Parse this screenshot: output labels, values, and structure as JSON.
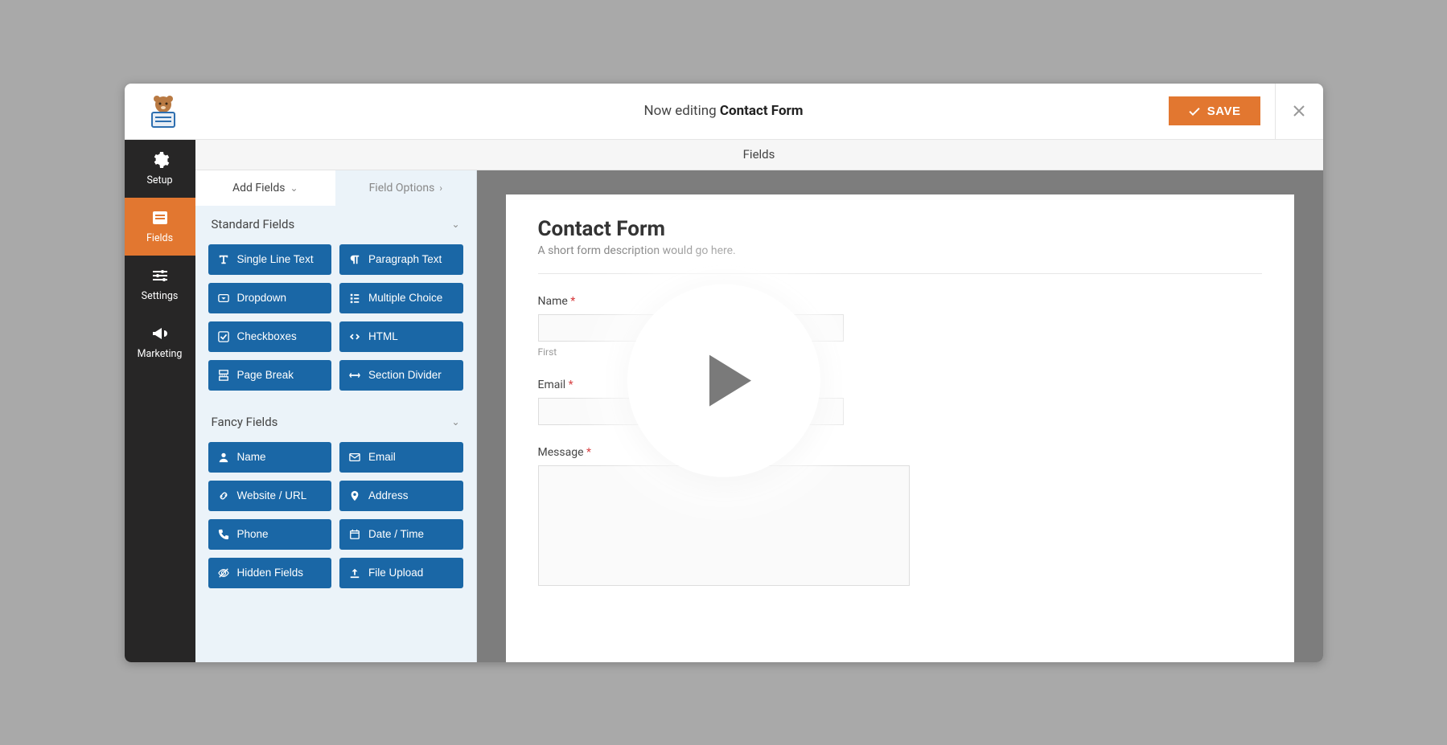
{
  "header": {
    "editing_prefix": "Now editing ",
    "form_name": "Contact Form",
    "save_label": "SAVE"
  },
  "rail": {
    "setup": "Setup",
    "fields": "Fields",
    "settings": "Settings",
    "marketing": "Marketing"
  },
  "panel_title": "Fields",
  "tabs": {
    "add_fields": "Add Fields",
    "field_options": "Field Options"
  },
  "sections": {
    "standard": "Standard Fields",
    "fancy": "Fancy Fields"
  },
  "standard_fields": {
    "single_line": "Single Line Text",
    "paragraph": "Paragraph Text",
    "dropdown": "Dropdown",
    "multiple_choice": "Multiple Choice",
    "checkboxes": "Checkboxes",
    "html": "HTML",
    "page_break": "Page Break",
    "section_divider": "Section Divider"
  },
  "fancy_fields": {
    "name": "Name",
    "email": "Email",
    "website": "Website / URL",
    "address": "Address",
    "phone": "Phone",
    "datetime": "Date / Time",
    "hidden": "Hidden Fields",
    "upload": "File Upload"
  },
  "preview": {
    "title": "Contact Form",
    "description": "A short form description would go here.",
    "name_label": "Name",
    "name_sub_first": "First",
    "email_label": "Email",
    "message_label": "Message"
  }
}
